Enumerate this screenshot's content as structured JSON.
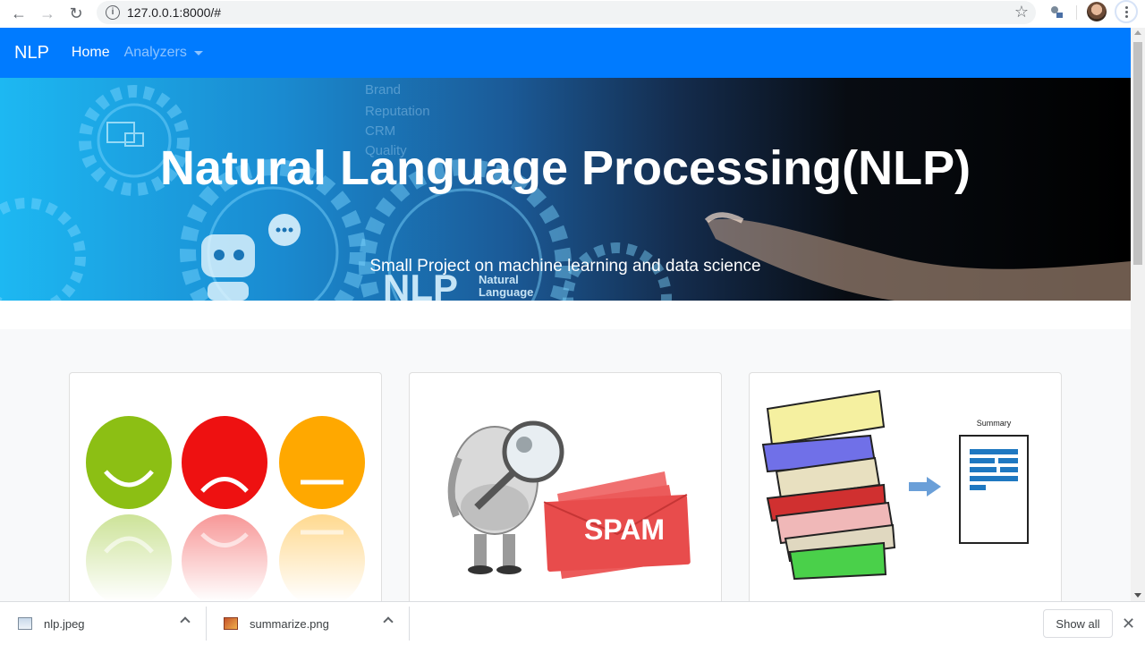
{
  "browser": {
    "url": "127.0.0.1:8000/#"
  },
  "navbar": {
    "brand": "NLP",
    "home": "Home",
    "analyzers": "Analyzers"
  },
  "hero": {
    "title": "Natural Language Processing(NLP)",
    "subtitle": "Small Project on machine learning and data science",
    "image_text": "NLP",
    "image_caption_1": "Natural",
    "image_caption_2": "Language",
    "background_words": [
      "Brand",
      "Reputation",
      "CRM",
      "Quality"
    ]
  },
  "cards": {
    "spam_label": "SPAM",
    "summary_label": "Summary"
  },
  "downloads": {
    "items": [
      {
        "name": "nlp.jpeg"
      },
      {
        "name": "summarize.png"
      }
    ],
    "show_all": "Show all"
  },
  "colors": {
    "navbar": "#007bff",
    "happy": "#8cbf14",
    "sad": "#ee1111",
    "neutral": "#ffa800",
    "spam_envelope": "#e84c4c",
    "summary_bars": "#1f78c1"
  }
}
